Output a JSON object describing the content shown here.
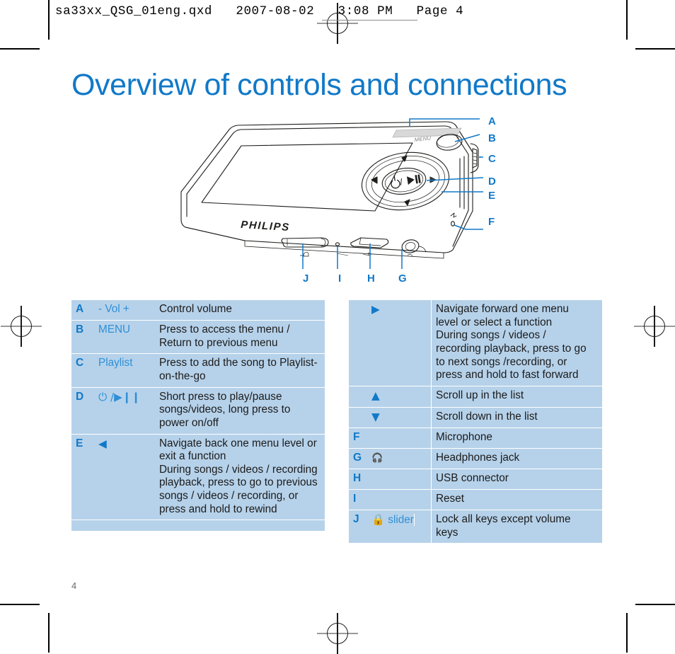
{
  "slug": {
    "text": "sa33xx_QSG_01eng.qxd   2007-08-02   3:08 PM   Page 4"
  },
  "page": {
    "title": "Overview of controls and connections",
    "number": "4",
    "brand": "PHILIPS",
    "menu_label": "MENU",
    "play_glyph": "⏻ /▶❙❙"
  },
  "callouts": {
    "right": [
      "A",
      "B",
      "C",
      "D",
      "E",
      "F"
    ],
    "bottom": [
      "J",
      "I",
      "H",
      "G"
    ]
  },
  "colors": {
    "accent": "#1179c8",
    "table_bg": "#b6d2ea",
    "table_rule": "#ffffff",
    "text": "#1b1b1b",
    "page_num": "#6a6a6a"
  },
  "table_left": [
    {
      "key": "A",
      "control": "- Vol +",
      "control_icon": "",
      "desc": "Control volume"
    },
    {
      "key": "B",
      "control": "MENU",
      "control_icon": "",
      "desc": "Press to access the menu /\nReturn to previous menu"
    },
    {
      "key": "C",
      "control": "Playlist",
      "control_icon": "",
      "desc": "Press to add the song to Playlist-\non-the-go"
    },
    {
      "key": "D",
      "control": "",
      "control_icon": "power-play-pause-icon",
      "desc": "Short press to play/pause\nsongs/videos, long press to\npower on/off"
    },
    {
      "key": "E",
      "control": "",
      "control_icon": "left-triangle-icon",
      "desc": "Navigate back one menu level or\nexit a function\nDuring songs / videos / recording\nplayback, press to go to previous\nsongs / videos / recording, or\npress and hold to rewind"
    }
  ],
  "table_right": [
    {
      "key": "",
      "control": "",
      "control_icon": "right-triangle-icon",
      "desc": "Navigate forward one menu\nlevel or select a function\nDuring songs / videos /\nrecording playback, press to go\nto next songs /recording, or\npress and hold to fast forward"
    },
    {
      "key": "",
      "control": "",
      "control_icon": "up-triangle-icon",
      "desc": "Scroll up in the list"
    },
    {
      "key": "",
      "control": "",
      "control_icon": "down-triangle-icon",
      "desc": "Scroll down in the list"
    },
    {
      "key": "F",
      "control": "",
      "control_icon": "",
      "desc": "Microphone"
    },
    {
      "key": "G",
      "control": "",
      "control_icon": "headphones-icon",
      "desc": "Headphones jack"
    },
    {
      "key": "H",
      "control": "",
      "control_icon": "",
      "desc": "USB connector"
    },
    {
      "key": "I",
      "control": "",
      "control_icon": "",
      "desc": "Reset"
    },
    {
      "key": "J",
      "control": "slider",
      "control_icon": "lock-icon",
      "desc": "Lock all keys except volume\nkeys"
    }
  ]
}
